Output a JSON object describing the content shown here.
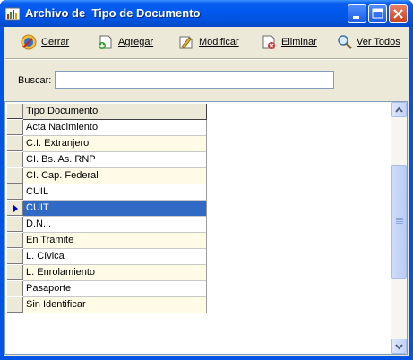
{
  "window": {
    "title": "Archivo de  Tipo de Documento"
  },
  "toolbar": {
    "cerrar": {
      "label": "Cerrar",
      "icon": "exit-icon"
    },
    "agregar": {
      "label": "Agregar",
      "icon": "add-document-icon"
    },
    "modificar": {
      "label": "Modificar",
      "icon": "edit-document-icon"
    },
    "eliminar": {
      "label": "Eliminar",
      "icon": "delete-document-icon"
    },
    "ver_todos": {
      "label": "Ver Todos",
      "icon": "magnifier-icon"
    }
  },
  "search": {
    "label": "Buscar:",
    "value": ""
  },
  "grid": {
    "column_header": "Tipo Documento",
    "rows": [
      "Acta Nacimiento",
      "C.I. Extranjero",
      "CI. Bs. As. RNP",
      "CI. Cap. Federal",
      "CUIL",
      "CUIT",
      "D.N.I.",
      "En Tramite",
      "L. Cívica",
      "L. Enrolamiento",
      "Pasaporte",
      "Sin Identificar"
    ],
    "selected_row": "CUIT"
  },
  "colors": {
    "selection": "#316ac5",
    "alt_row": "#fffbe6",
    "titlebar": "#0058ee"
  }
}
